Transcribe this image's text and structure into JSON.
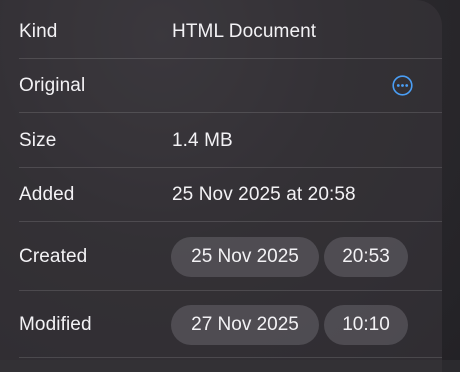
{
  "info": {
    "rows": [
      {
        "label": "Kind",
        "value": "HTML Document"
      },
      {
        "label": "Original",
        "icon": "more-ellipsis-circle-icon"
      },
      {
        "label": "Size",
        "value": "1.4 MB"
      },
      {
        "label": "Added",
        "value": "25 Nov 2025 at 20:58"
      },
      {
        "label": "Created",
        "date": "25 Nov 2025",
        "time": "20:53"
      },
      {
        "label": "Modified",
        "date": "27 Nov 2025",
        "time": "10:10"
      }
    ]
  },
  "colors": {
    "accent": "#4a9ef5",
    "text": "#f3f2f5",
    "pill_background": "#5a575e"
  }
}
